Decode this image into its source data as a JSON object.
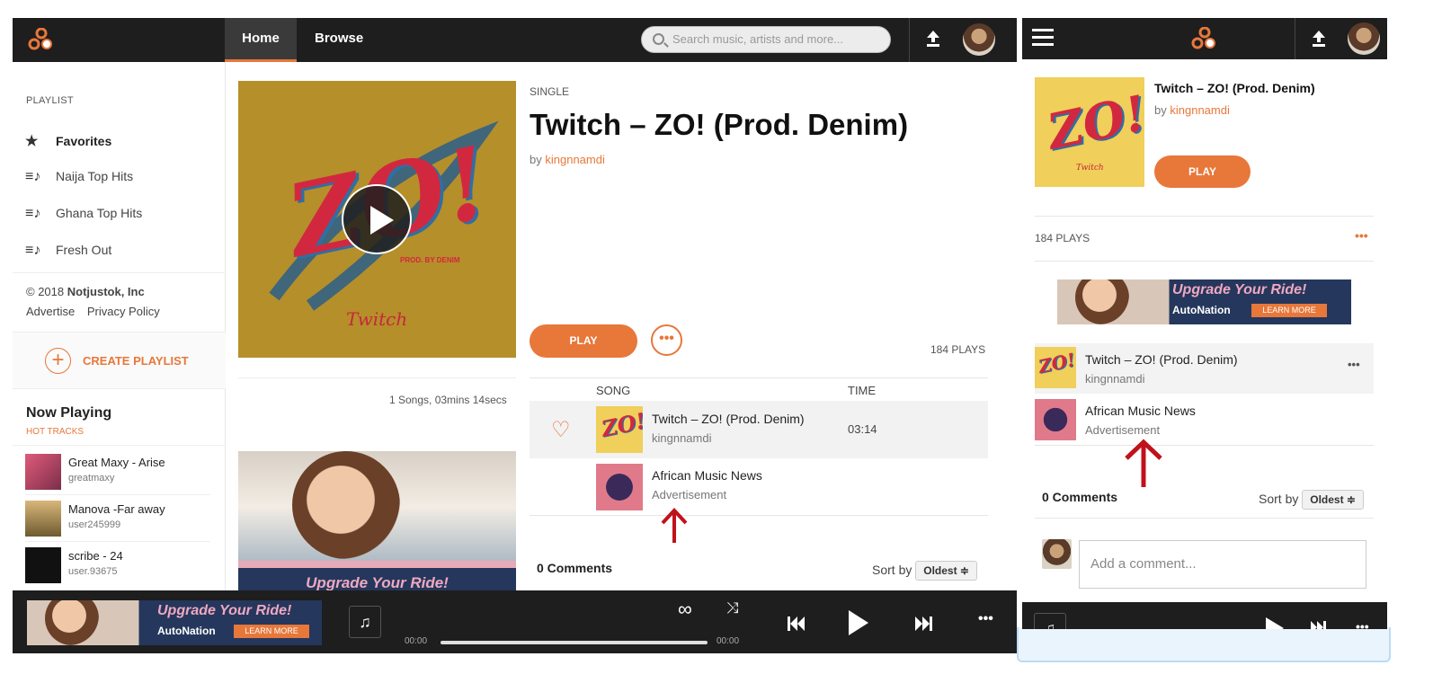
{
  "desktop": {
    "nav": {
      "home": "Home",
      "browse": "Browse"
    },
    "search": {
      "placeholder": "Search music, artists and more..."
    },
    "sidebar": {
      "heading": "PLAYLIST",
      "items": [
        {
          "label": "Favorites",
          "icon": "star-icon"
        },
        {
          "label": "Naija Top Hits",
          "icon": "playlist-icon"
        },
        {
          "label": "Ghana Top Hits",
          "icon": "playlist-icon"
        },
        {
          "label": "Fresh Out",
          "icon": "playlist-icon"
        }
      ],
      "copyright_prefix": "© 2018",
      "company": "Notjustok, Inc",
      "advertise": "Advertise",
      "privacy": "Privacy Policy",
      "create_playlist": "CREATE PLAYLIST",
      "now_playing": "Now Playing",
      "hot_tracks": "HOT TRACKS",
      "tracks": [
        {
          "title": "Great Maxy - Arise",
          "user": "greatmaxy"
        },
        {
          "title": "Manova -Far away",
          "user": "user245999"
        },
        {
          "title": "scribe - 24",
          "user": "user.93675"
        }
      ]
    },
    "main": {
      "kind": "SINGLE",
      "title": "Twitch – ZO! (Prod. Denim)",
      "by": "by",
      "artist": "kingnnamdi",
      "play": "PLAY",
      "plays": "184 PLAYS",
      "summary": "1 Songs, 03mins 14secs",
      "col_song": "SONG",
      "col_time": "TIME",
      "songs": [
        {
          "title": "Twitch – ZO! (Prod. Denim)",
          "artist": "kingnnamdi",
          "time": "03:14"
        },
        {
          "title": "African Music News",
          "artist": "Advertisement",
          "time": ""
        }
      ],
      "comments": "0 Comments",
      "sort_by": "Sort by",
      "sort_value": "Oldest ≑",
      "ad_text": "Upgrade Your Ride!"
    },
    "cover": {
      "zo": "ZO!",
      "prod": "PROD. BY DENIM",
      "signature": "Twitch"
    },
    "player": {
      "ad_line": "Upgrade Your Ride!",
      "ad_brand": "AutoNation",
      "ad_cta": "LEARN MORE",
      "time_start": "00:00",
      "time_end": "00:00",
      "progress": 0
    }
  },
  "mobile": {
    "title": "Twitch – ZO! (Prod. Denim)",
    "by": "by",
    "artist": "kingnnamdi",
    "play": "PLAY",
    "plays": "184 PLAYS",
    "ad_line": "Upgrade Your Ride!",
    "ad_brand": "AutoNation",
    "ad_cta": "LEARN MORE",
    "songs": [
      {
        "title": "Twitch – ZO! (Prod. Denim)",
        "artist": "kingnnamdi"
      },
      {
        "title": "African Music News",
        "artist": "Advertisement"
      }
    ],
    "comments": "0 Comments",
    "sort_by": "Sort by",
    "sort_value": "Oldest ≑",
    "comment_placeholder": "Add a comment..."
  },
  "colors": {
    "accent": "#e8773a",
    "topbar": "#1e1e1e",
    "arrow": "#c0121b"
  }
}
